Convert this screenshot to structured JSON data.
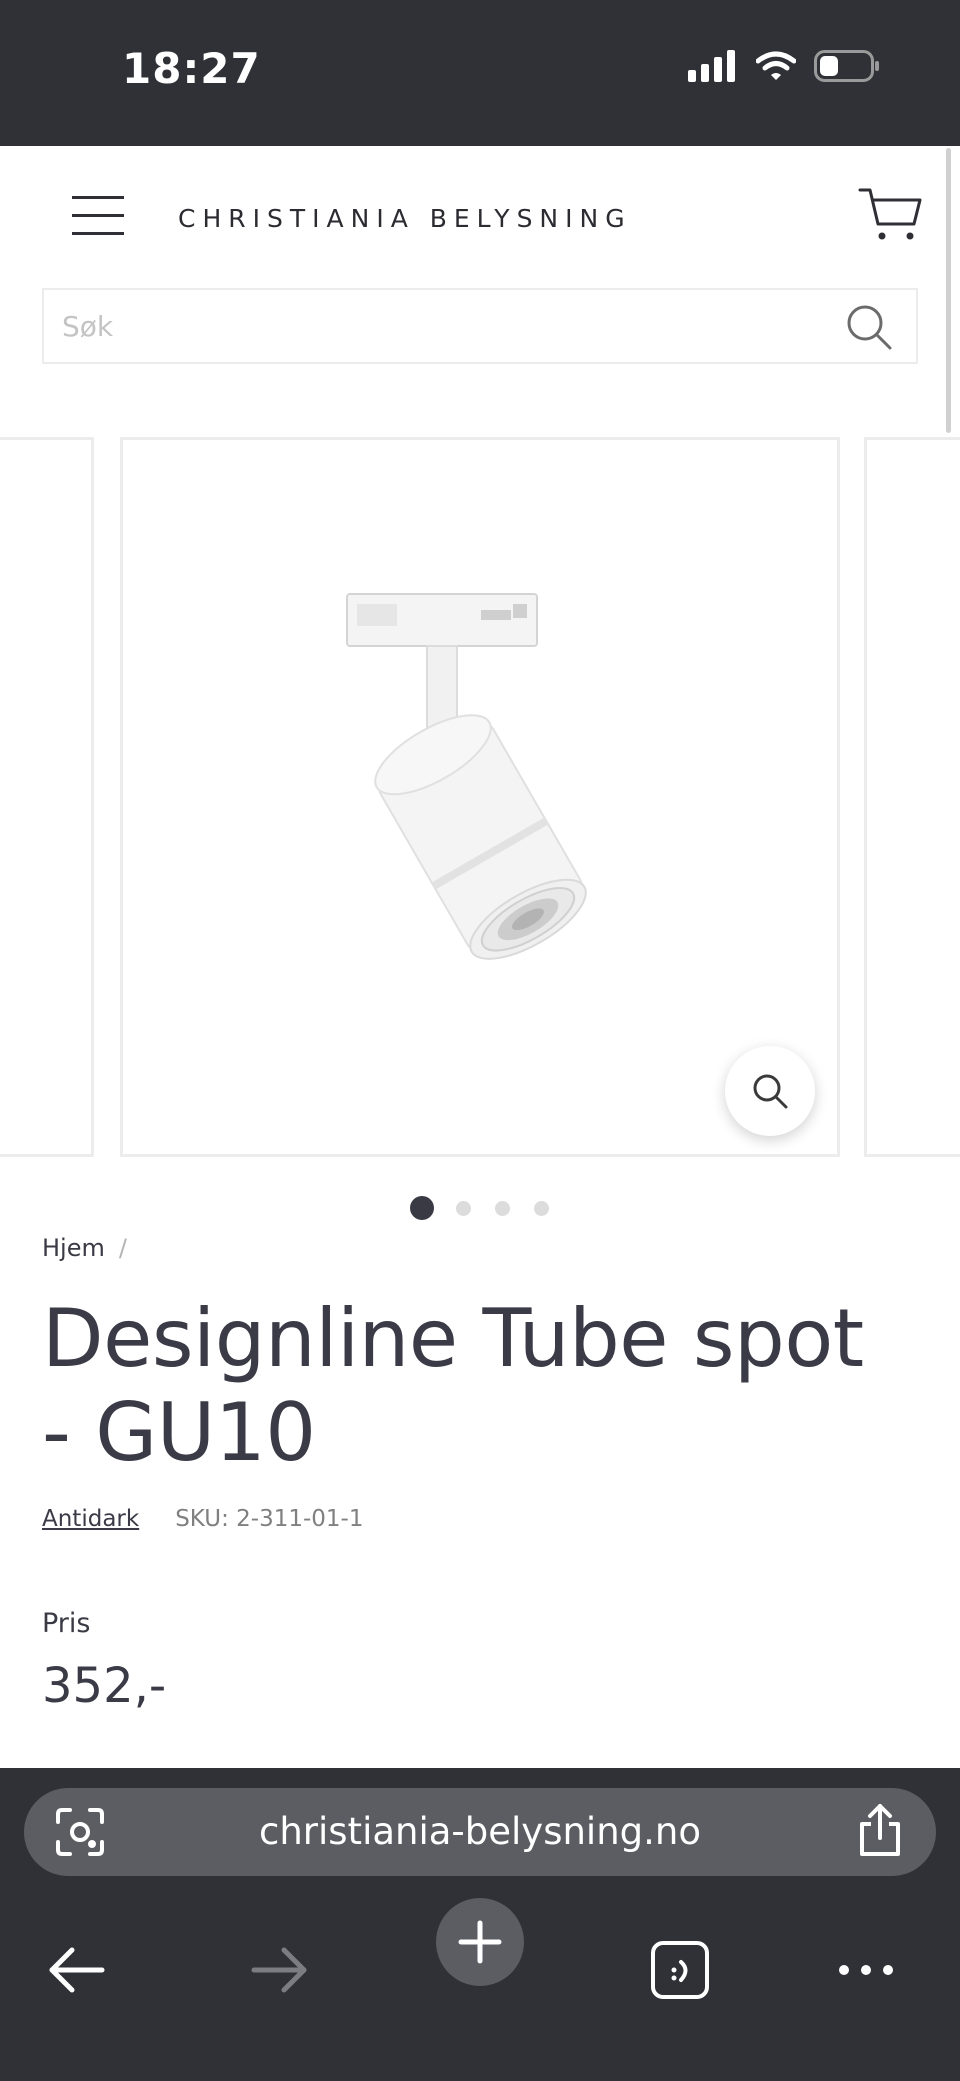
{
  "status_bar": {
    "time": "18:27"
  },
  "header": {
    "brand_name": "CHRISTIANIA BELYSNING",
    "search_placeholder": "Søk"
  },
  "carousel": {
    "slide_count": 4,
    "active_index": 0
  },
  "breadcrumb": {
    "home_label": "Hjem",
    "separator": "/"
  },
  "product": {
    "title": "Designline Tube spot - GU10",
    "brand_link": "Antidark",
    "sku": "SKU: 2-311-01-1",
    "price_label": "Pris",
    "price_value": "352,-"
  },
  "browser": {
    "url": "christiania-belysning.no"
  },
  "colors": {
    "chrome_dark": "#2f3136",
    "pill_grey": "#5b5d63",
    "text_dark": "#3b3b47"
  }
}
